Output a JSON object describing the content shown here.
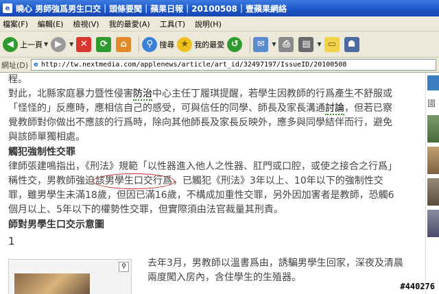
{
  "window": {
    "title": "曉心 男師強爲男生口交｜頭條要聞｜蘋果日報｜20100508｜壹蘋果網絡"
  },
  "menu": [
    "檔案(F)",
    "編輯(E)",
    "檢視(V)",
    "我的最愛(A)",
    "工具(T)",
    "說明(H)"
  ],
  "toolbar": {
    "back_label": "上一頁",
    "search_label": "搜尋",
    "favorites_label": "我的最愛"
  },
  "address": {
    "label": "網址(D)",
    "url": "http://tw.nextmedia.com/applenews/article/art_id/32497197/IssueID/20100508"
  },
  "article": {
    "p0": "程。",
    "p1_a": "對此，北縣家庭暴力暨性侵害",
    "p1_link1": "防治",
    "p1_b": "中心主任丁履琪提醒，若學生因教師的行爲產生不舒服或「怪怪的」反應時，應相信自己的感受，可與信任的同學、師長及家長溝通",
    "p1_link2": "討論",
    "p1_c": "，但若已察覺教師對你做出不應該的行爲時，除向其他師長及家長反映外，應多與同學結伴而行，避免與該師單獨相處。",
    "heading1": "觸犯強制性交罪",
    "p2_a": "律師張建鳴指出，《刑法》規範「以性器進入他人之性器、肛門或口腔，或使之接合之行爲」稱性交，男教師強迫",
    "p2_circled": "該男學生口交行爲",
    "p2_b": "，已觸犯《刑法》3年以上、10年以下的強制性交罪，雖男學生未滿18歲，但因已滿16歲，不構成加重性交罪，另外因加害者是教師，恐觸6個月以上、5年以下的權勢性交罪，但實際須由法官裁量其刑責。",
    "heading2": "師對男學生口交示意圖",
    "figure_number": "1",
    "side_text": "去年3月，男教師以溫書爲由，誘騙男學生回家，深夜及清晨兩度闖入房內，含住學生的生殖器。"
  },
  "sidebar": {
    "text": "國"
  },
  "watermark": "#440276"
}
